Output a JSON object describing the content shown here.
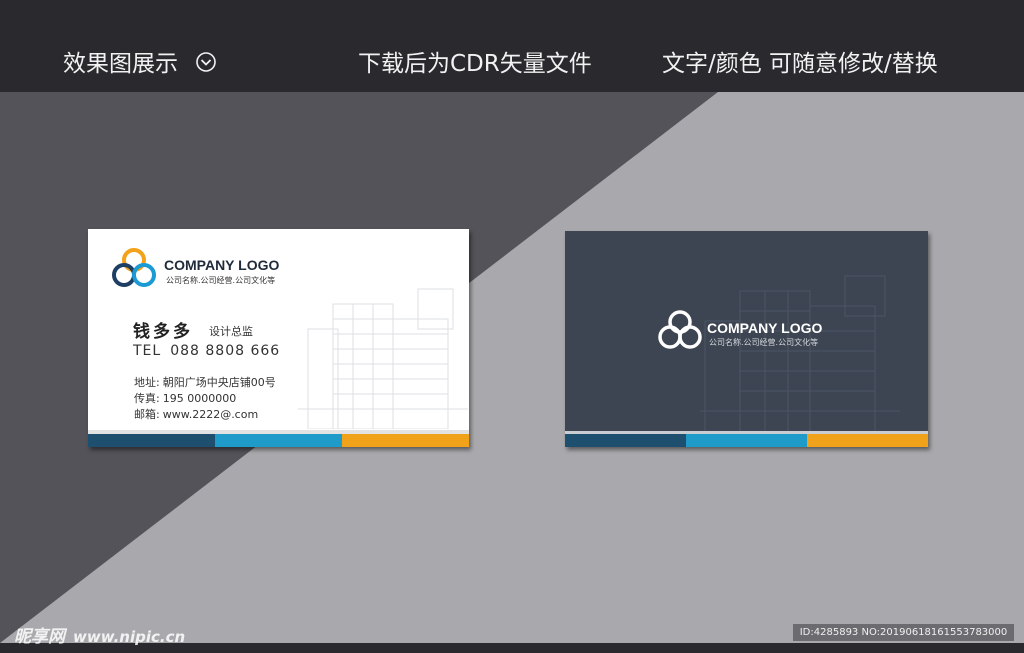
{
  "header": {
    "title": "效果图展示",
    "chevron_icon": "chevron-down-circle-icon",
    "note1": "下载后为CDR矢量文件",
    "note2": "文字/颜色  可随意修改/替换"
  },
  "colors": {
    "topbar": "#2a2a2e",
    "dark_triangle": "#545359",
    "light_bg": "#a9a9ad",
    "card_back": "#3d4552",
    "strip_navy": "#1e4f6e",
    "strip_blue": "#1e9bc9",
    "strip_orange": "#f0a21a",
    "ring_orange": "#f2a21b",
    "ring_blue": "#1b9ad3",
    "ring_navy": "#1d3f63"
  },
  "front_card": {
    "company": "COMPANY LOGO",
    "company_sub": "公司名称.公司经营.公司文化等",
    "name": "钱多多",
    "title": "设计总监",
    "tel_label": "TEL",
    "tel_value": "088 8808 666",
    "address_label": "地址:",
    "address": "朝阳广场中央店铺00号",
    "fax_label": "传真:",
    "fax": "195  0000000",
    "email_label": "邮箱:",
    "email": "www.2222@.com"
  },
  "back_card": {
    "company": "COMPANY LOGO",
    "company_sub": "公司名称.公司经营.公司文化等"
  },
  "watermark": {
    "brand": "昵享网",
    "site": "www.nipic.cn",
    "id_text": "ID:4285893 NO:20190618161553783000"
  }
}
